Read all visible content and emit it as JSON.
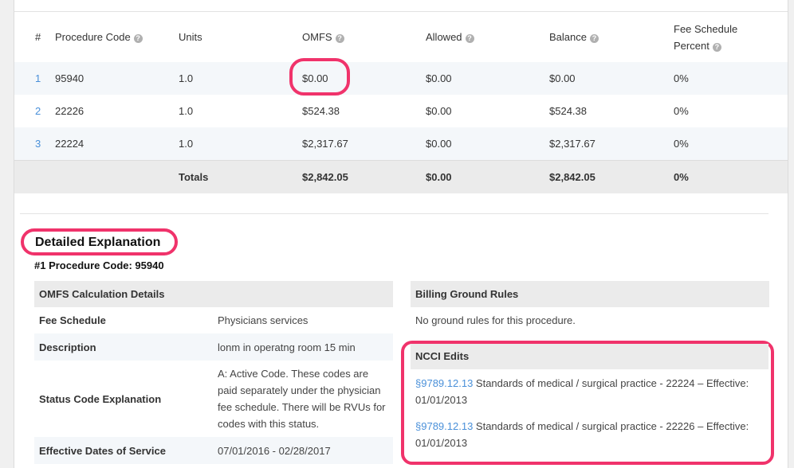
{
  "table": {
    "headers": {
      "num": "#",
      "code": "Procedure Code",
      "units": "Units",
      "omfs": "OMFS",
      "allowed": "Allowed",
      "balance": "Balance",
      "fsp_line1": "Fee Schedule",
      "fsp_line2": "Percent"
    },
    "rows": [
      {
        "num": "1",
        "code": "95940",
        "units": "1.0",
        "omfs": "$0.00",
        "allowed": "$0.00",
        "balance": "$0.00",
        "fsp": "0%"
      },
      {
        "num": "2",
        "code": "22226",
        "units": "1.0",
        "omfs": "$524.38",
        "allowed": "$0.00",
        "balance": "$524.38",
        "fsp": "0%"
      },
      {
        "num": "3",
        "code": "22224",
        "units": "1.0",
        "omfs": "$2,317.67",
        "allowed": "$0.00",
        "balance": "$2,317.67",
        "fsp": "0%"
      }
    ],
    "totals": {
      "label": "Totals",
      "omfs": "$2,842.05",
      "allowed": "$0.00",
      "balance": "$2,842.05",
      "fsp": "0%"
    }
  },
  "detail": {
    "title": "Detailed Explanation",
    "subtitle": "#1 Procedure Code: 95940",
    "omfs_panel": {
      "title": "OMFS Calculation Details",
      "rows": [
        {
          "key": "Fee Schedule",
          "value": "Physicians services"
        },
        {
          "key": "Description",
          "value": "lonm in operatng room 15 min"
        },
        {
          "key": "Status Code Explanation",
          "value": "A: Active Code. These codes are paid separately under the physician fee schedule. There will be RVUs for codes with this status."
        },
        {
          "key": "Effective Dates of Service",
          "value": "07/01/2016 - 02/28/2017"
        }
      ]
    },
    "billing_panel": {
      "title": "Billing Ground Rules",
      "text": "No ground rules for this procedure."
    },
    "ncci": {
      "title": "NCCI Edits",
      "items": [
        {
          "link": "§9789.12.13",
          "text": " Standards of medical / surgical practice - 22224 – Effective: 01/01/2013"
        },
        {
          "link": "§9789.12.13",
          "text": " Standards of medical / surgical practice - 22226 – Effective: 01/01/2013"
        }
      ]
    }
  },
  "colors": {
    "highlight": "#f0336b",
    "link": "#4a90d9",
    "stripe": "#f4f7fa",
    "header_bg": "#ebebeb"
  },
  "icons": {
    "help": "question-circle-icon"
  }
}
